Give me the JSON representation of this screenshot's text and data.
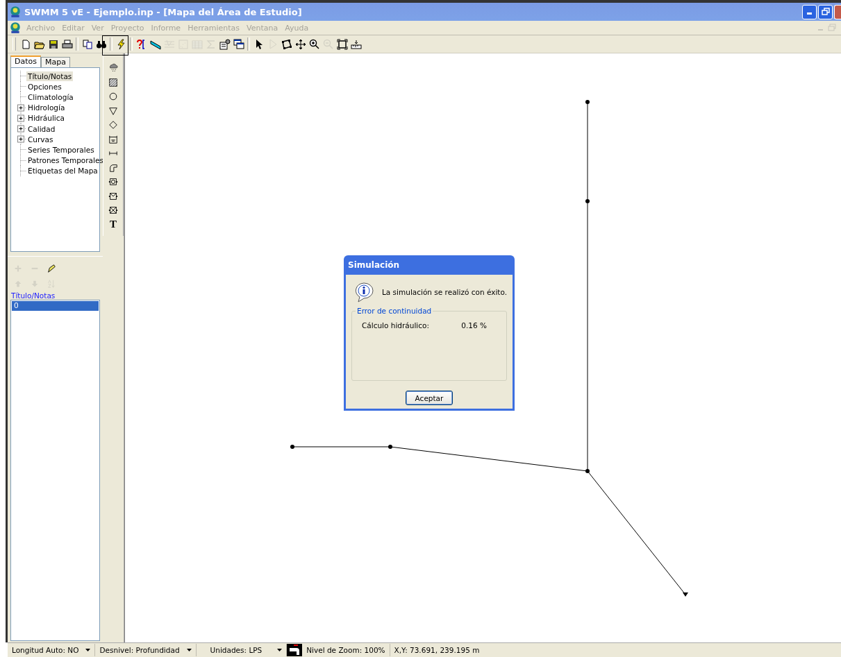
{
  "window": {
    "title": "SWMM 5 vE - Ejemplo.inp - [Mapa del Área de Estudio]"
  },
  "menu": [
    {
      "label": "Archivo"
    },
    {
      "label": "Editar"
    },
    {
      "label": "Ver"
    },
    {
      "label": "Proyecto"
    },
    {
      "label": "Informe"
    },
    {
      "label": "Herramientas"
    },
    {
      "label": "Ventana"
    },
    {
      "label": "Ayuda"
    }
  ],
  "toolbar": [
    {
      "kind": "new",
      "disabled": false
    },
    {
      "kind": "open",
      "disabled": false
    },
    {
      "kind": "save",
      "disabled": false
    },
    {
      "kind": "print",
      "disabled": false
    },
    {
      "kind": "separator",
      "disabled": false
    },
    {
      "kind": "copy",
      "disabled": false
    },
    {
      "kind": "find",
      "disabled": false
    },
    {
      "kind": "separator",
      "disabled": false
    },
    {
      "kind": "run",
      "disabled": false
    },
    {
      "kind": "separator",
      "disabled": false
    },
    {
      "kind": "query",
      "disabled": false
    },
    {
      "kind": "profile",
      "disabled": false
    },
    {
      "kind": "graph",
      "disabled": true
    },
    {
      "kind": "scatter",
      "disabled": true
    },
    {
      "kind": "table",
      "disabled": true
    },
    {
      "kind": "sigma",
      "disabled": true
    },
    {
      "kind": "options",
      "disabled": false
    },
    {
      "kind": "windows",
      "disabled": false
    },
    {
      "kind": "separator",
      "disabled": false
    },
    {
      "kind": "select",
      "disabled": false
    },
    {
      "kind": "vertex",
      "disabled": true
    },
    {
      "kind": "region",
      "disabled": false
    },
    {
      "kind": "pan",
      "disabled": false
    },
    {
      "kind": "zoomin",
      "disabled": false
    },
    {
      "kind": "zoomout",
      "disabled": true
    },
    {
      "kind": "extent",
      "disabled": false
    },
    {
      "kind": "measure",
      "disabled": false
    }
  ],
  "tabs": [
    {
      "label": "Datos",
      "selected": true
    },
    {
      "label": "Mapa",
      "selected": false
    }
  ],
  "tree": [
    {
      "label": "Título/Notas",
      "selected": true
    },
    {
      "label": "Opciones",
      "selected": false
    },
    {
      "label": "Climatología",
      "selected": false
    },
    {
      "label": "Hidrología",
      "selected": false,
      "expanded": false
    },
    {
      "label": "Hidráulica",
      "selected": false,
      "expanded": false
    },
    {
      "label": "Calidad",
      "selected": false,
      "expanded": false
    },
    {
      "label": "Curvas",
      "selected": false,
      "expanded": false
    },
    {
      "label": "Series Temporales",
      "selected": false
    },
    {
      "label": "Patrones Temporales",
      "selected": false
    },
    {
      "label": "Etiquetas del Mapa",
      "selected": false
    }
  ],
  "object_list": {
    "heading": "Título/Notas",
    "items": [
      {
        "label": "0",
        "selected": true
      }
    ]
  },
  "object_toolbar": [
    {
      "kind": "add",
      "disabled": true
    },
    {
      "kind": "remove",
      "disabled": true
    },
    {
      "kind": "edit",
      "disabled": false
    },
    {
      "kind": "up",
      "disabled": true
    },
    {
      "kind": "down",
      "disabled": true
    },
    {
      "kind": "sort",
      "disabled": true
    }
  ],
  "map_toolbar": [
    {
      "kind": "rain"
    },
    {
      "kind": "subcatchment"
    },
    {
      "kind": "junction"
    },
    {
      "kind": "outfall"
    },
    {
      "kind": "divider"
    },
    {
      "kind": "storage"
    },
    {
      "kind": "conduit"
    },
    {
      "kind": "pump"
    },
    {
      "kind": "orifice"
    },
    {
      "kind": "weir"
    },
    {
      "kind": "outlet"
    },
    {
      "kind": "label",
      "text": "T"
    }
  ],
  "dialog": {
    "title": "Simulación",
    "message": "La simulación se realizó con éxito.",
    "group_title": "Error de continuidad",
    "rows": [
      {
        "label": "Cálculo hidráulico:",
        "value": "0.16 %"
      }
    ],
    "button": "Aceptar"
  },
  "status_bar": {
    "auto_length": "Longitud Auto: NO",
    "offset": "Desnivel: Profundidad",
    "units": "Unidades: LPS",
    "zoom": "Nivel de Zoom: 100%",
    "xy": "X,Y: 73.691, 239.195 m"
  }
}
